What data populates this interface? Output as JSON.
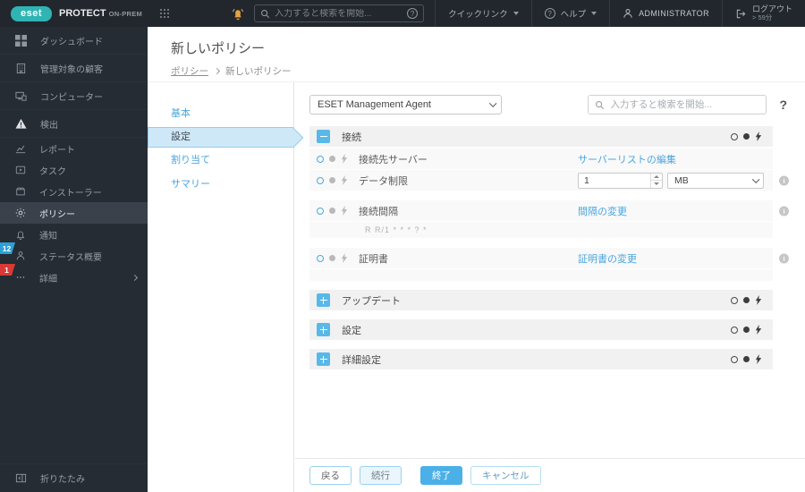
{
  "topbar": {
    "logo_text": "eset",
    "product_name": "PROTECT",
    "product_edition": "ON-PREM",
    "search_placeholder": "入力すると検索を開始...",
    "quick_links_label": "クイックリンク",
    "help_label": "ヘルプ",
    "user_label": "ADMINISTRATOR",
    "logout_label": "ログアウト",
    "logout_timer": "> 59分"
  },
  "sidebar": {
    "items": [
      {
        "label": "ダッシュボード"
      },
      {
        "label": "管理対象の顧客"
      },
      {
        "label": "コンピューター"
      },
      {
        "label": "検出"
      },
      {
        "label": "レポート"
      },
      {
        "label": "タスク"
      },
      {
        "label": "インストーラー"
      },
      {
        "label": "ポリシー",
        "selected": true
      },
      {
        "label": "通知"
      },
      {
        "label": "ステータス概要",
        "badge": "12"
      },
      {
        "label": "詳細",
        "badge": "1"
      }
    ],
    "collapse_label": "折りたたみ"
  },
  "page": {
    "title": "新しいポリシー",
    "breadcrumb": {
      "parent": "ポリシー",
      "current": "新しいポリシー"
    }
  },
  "wizard": {
    "steps": [
      {
        "label": "基本"
      },
      {
        "label": "設定",
        "active": true
      },
      {
        "label": "割り当て"
      },
      {
        "label": "サマリー"
      }
    ]
  },
  "settings": {
    "product_selector_value": "ESET Management Agent",
    "search_placeholder": "入力すると検索を開始...",
    "help_label": "?",
    "connection": {
      "title": "接続",
      "rows": {
        "server": {
          "label": "接続先サーバー",
          "action": "サーバーリストの編集"
        },
        "data_limit": {
          "label": "データ制限",
          "value": "1",
          "unit": "MB"
        },
        "interval": {
          "label": "接続間隔",
          "action": "間隔の変更",
          "cron": "R R/1 * * * ? *"
        },
        "certificate": {
          "label": "証明書",
          "action": "証明書の変更"
        }
      }
    },
    "collapsed_sections": [
      {
        "title": "アップデート"
      },
      {
        "title": "設定"
      },
      {
        "title": "詳細設定"
      }
    ]
  },
  "footer": {
    "back": "戻る",
    "continue": "続行",
    "finish": "終了",
    "cancel": "キャンセル"
  },
  "colors": {
    "brand_teal": "#2fb4b4",
    "accent_blue": "#4aa6de",
    "button_blue": "#4bb0e8",
    "badge_blue": "#2da0d8",
    "badge_red": "#d93a36",
    "notification_orange": "#e8a33d",
    "topbar_bg": "#22272d",
    "sidebar_bg": "#262c33"
  }
}
